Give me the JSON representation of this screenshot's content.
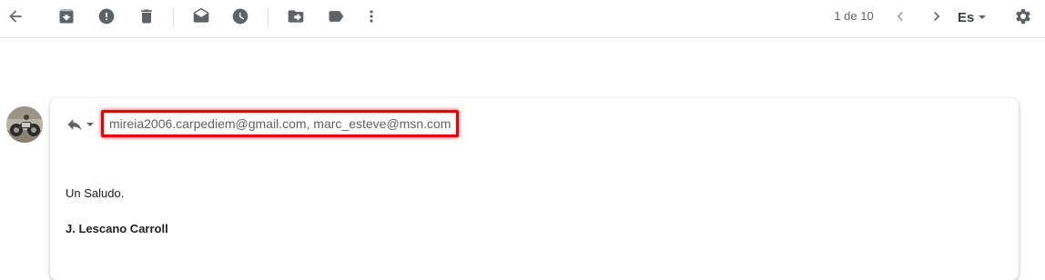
{
  "toolbar": {
    "icons": [
      "back-arrow-icon",
      "archive-icon",
      "report-spam-icon",
      "delete-icon",
      "mark-unread-icon",
      "snooze-icon",
      "move-to-icon",
      "label-icon",
      "more-vert-icon"
    ],
    "pager": "1 de 10",
    "language": "Es",
    "settings_icon": "gear-icon"
  },
  "message": {
    "avatar_icon": "motorcycle-avatar",
    "reply_icon": "reply-icon",
    "recipients": "mireia2006.carpediem@gmail.com, marc_esteve@msn.com",
    "highlight_color": "#e8000b",
    "greeting": "Un Saludo.",
    "signature": "J. Lescano Carroll"
  }
}
